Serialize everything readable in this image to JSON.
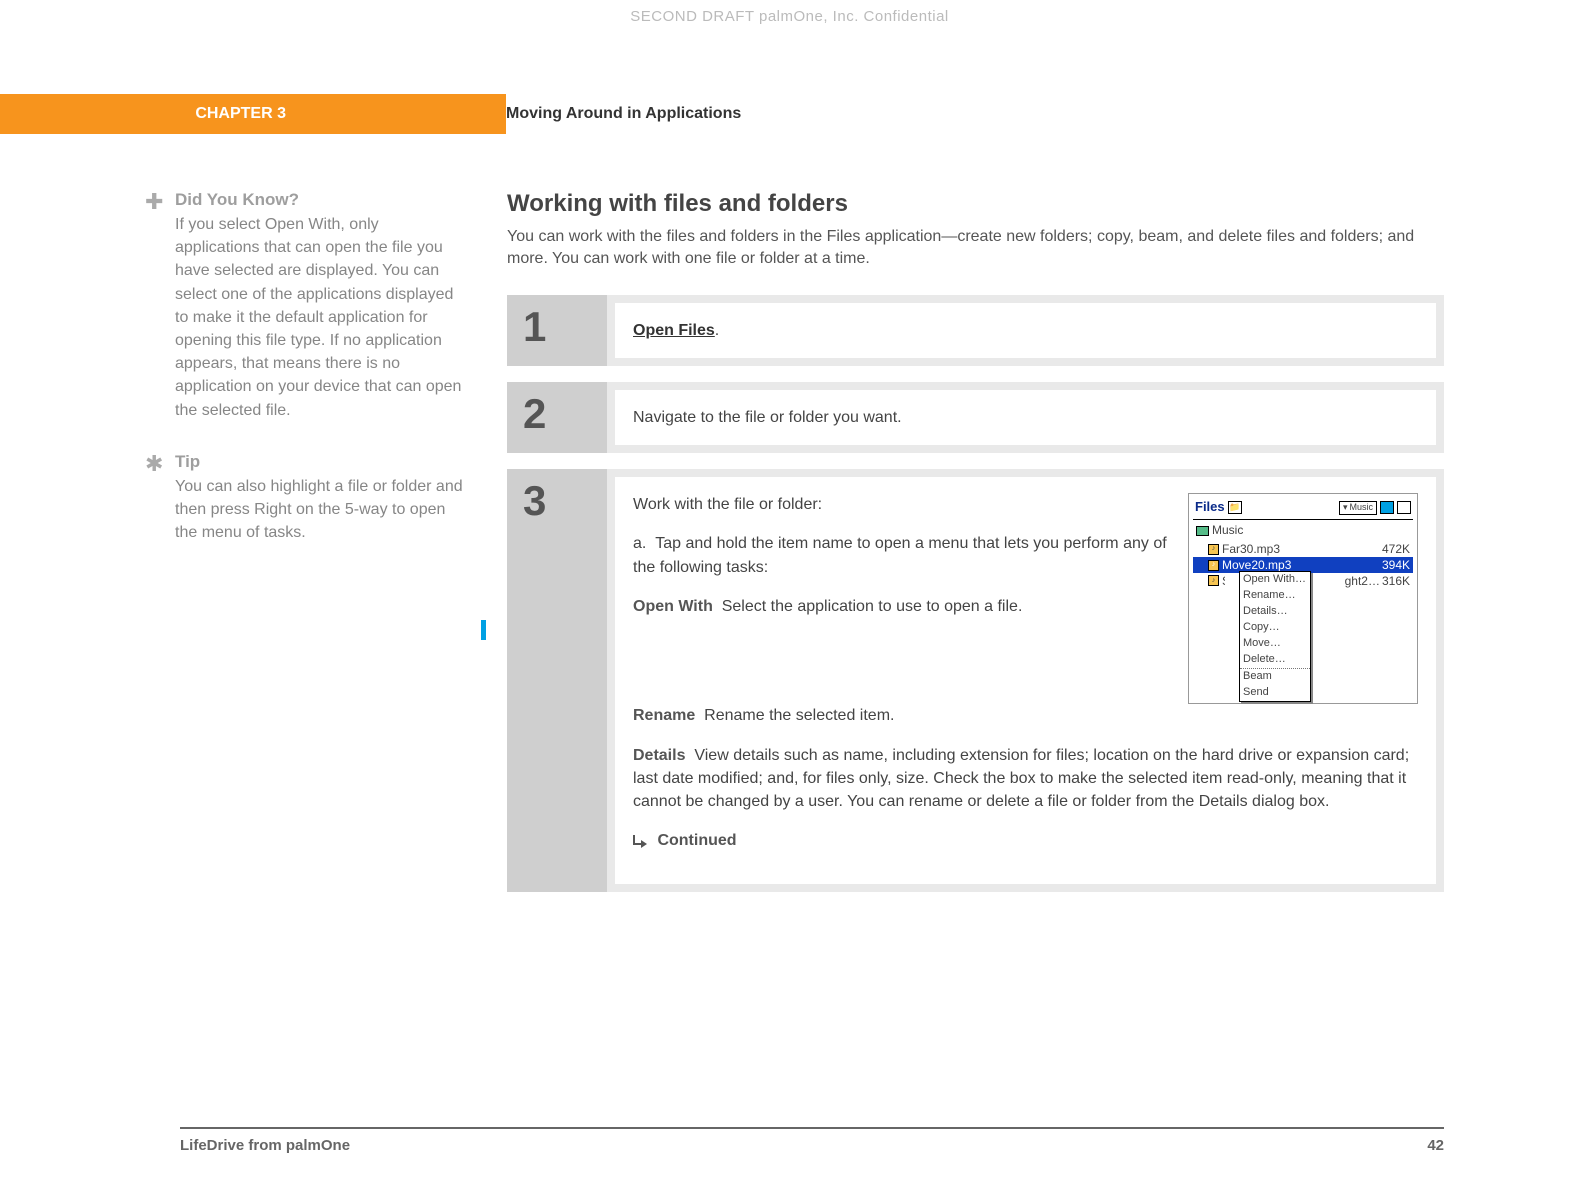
{
  "watermark": "SECOND DRAFT palmOne, Inc.  Confidential",
  "header": {
    "chapter": "CHAPTER 3",
    "title": "Moving Around in Applications"
  },
  "sidebar": {
    "dyk": {
      "title": "Did You Know?",
      "text": "If you select Open With, only applications that can open the file you have selected are displayed. You can select one of the applications displayed to make it the default application for opening this file type. If no application appears, that means there is no application on your device that can open the selected file."
    },
    "tip": {
      "title": "Tip",
      "text": "You can also highlight a file or folder and then press Right on the 5-way to open the menu of tasks."
    }
  },
  "main": {
    "heading": "Working with files and folders",
    "intro": "You can work with the files and folders in the Files application—create new folders; copy, beam, and delete files and folders; and more. You can work with one file or folder at a time.",
    "step1_link": "Open Files",
    "step1_dot": ".",
    "step2": "Navigate to the file or folder you want.",
    "step3": {
      "lead": "Work with the file or folder:",
      "a": "Tap and hold the item name to open a menu that lets you perform any of the following tasks:",
      "a_label": "a.",
      "open_with_label": "Open With",
      "open_with_text": "Select the application to use to open a file.",
      "rename_label": "Rename",
      "rename_text": "Rename the selected item.",
      "details_label": "Details",
      "details_text": "View details such as name, including extension for files; location on the hard drive or expansion card; last date modified; and, for files only, size. Check the box to make the selected item read-only, meaning that it cannot be changed by a user. You can rename or delete a file or folder from the Details dialog box.",
      "continued": "Continued"
    },
    "num1": "1",
    "num2": "2",
    "num3": "3"
  },
  "device": {
    "title": "Files",
    "dropdown": "Music",
    "crumb": "Music",
    "rows": [
      {
        "name": "Far30.mp3",
        "size": "472K"
      },
      {
        "name": "Move20.mp3",
        "size": "394K"
      },
      {
        "name_short": "S",
        "partial": "ght2…",
        "size": "316K"
      }
    ],
    "menu": [
      "Open With…",
      "Rename…",
      "Details…",
      "Copy…",
      "Move…",
      "Delete…",
      "Beam",
      "Send"
    ]
  },
  "footer": {
    "left": "LifeDrive from palmOne",
    "page": "42"
  }
}
